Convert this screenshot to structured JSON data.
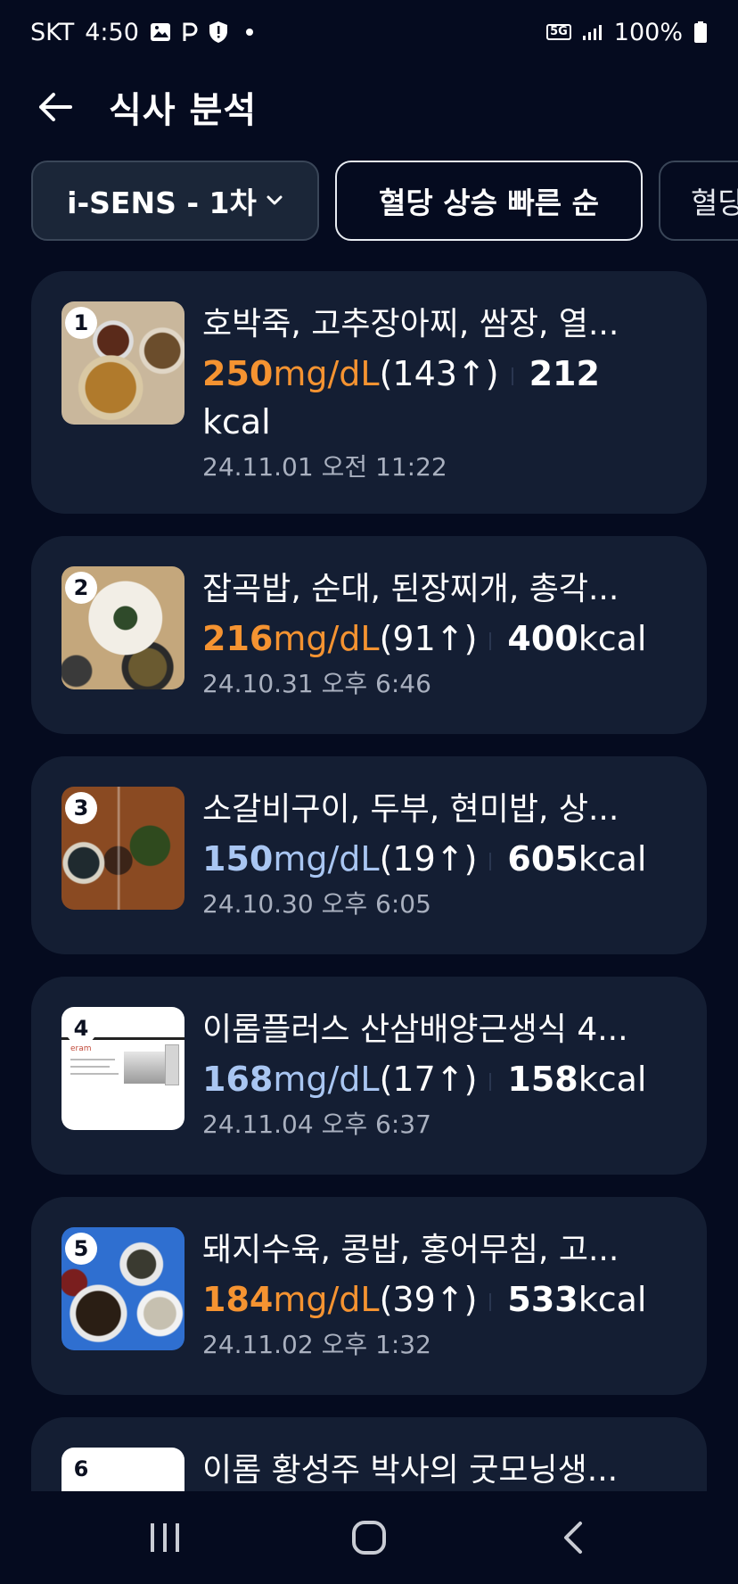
{
  "status_bar": {
    "carrier": "SKT",
    "time": "4:50",
    "network": "5G",
    "battery": "100%"
  },
  "header": {
    "title": "식사 분석"
  },
  "filters": {
    "device": "i-SENS - 1차",
    "sort": "혈당 상승 빠른 순",
    "third": "혈당"
  },
  "meals": [
    {
      "rank": "1",
      "name": "호박죽, 고추장아찌, 쌈장, 열...",
      "glucose": "250",
      "unit": "mg/dL",
      "rise": "(143↑)",
      "kcal": "212",
      "kcal_unit": "kcal",
      "date": "24.11.01 오전 11:22",
      "level": "high"
    },
    {
      "rank": "2",
      "name": "잡곡밥, 순대, 된장찌개, 총각...",
      "glucose": "216",
      "unit": "mg/dL",
      "rise": "(91↑)",
      "kcal": "400",
      "kcal_unit": "kcal",
      "date": "24.10.31 오후 6:46",
      "level": "high"
    },
    {
      "rank": "3",
      "name": "소갈비구이, 두부, 현미밥, 상...",
      "glucose": "150",
      "unit": "mg/dL",
      "rise": "(19↑)",
      "kcal": "605",
      "kcal_unit": "kcal",
      "date": "24.10.30 오후 6:05",
      "level": "mid"
    },
    {
      "rank": "4",
      "name": "이롬플러스 산삼배양근생식 4...",
      "glucose": "168",
      "unit": "mg/dL",
      "rise": "(17↑)",
      "kcal": "158",
      "kcal_unit": "kcal",
      "date": "24.11.04 오후 6:37",
      "level": "mid"
    },
    {
      "rank": "5",
      "name": "돼지수육, 콩밥, 홍어무침, 고...",
      "glucose": "184",
      "unit": "mg/dL",
      "rise": "(39↑)",
      "kcal": "533",
      "kcal_unit": "kcal",
      "date": "24.11.02 오후 1:32",
      "level": "high"
    },
    {
      "rank": "6",
      "name": "이롬 황성주 박사의 굿모닝생..."
    }
  ],
  "thumb_logo_text": "eram",
  "colors": {
    "background": "#050b1f",
    "card": "#141e33",
    "glucose_high": "#f59331",
    "glucose_mid": "#a9c6f2"
  },
  "icons": {
    "back": "back-arrow-icon",
    "chip_dropdown": "chevron-down-icon",
    "nav_recents": "recents-icon",
    "nav_home": "home-icon",
    "nav_back": "nav-back-icon"
  }
}
